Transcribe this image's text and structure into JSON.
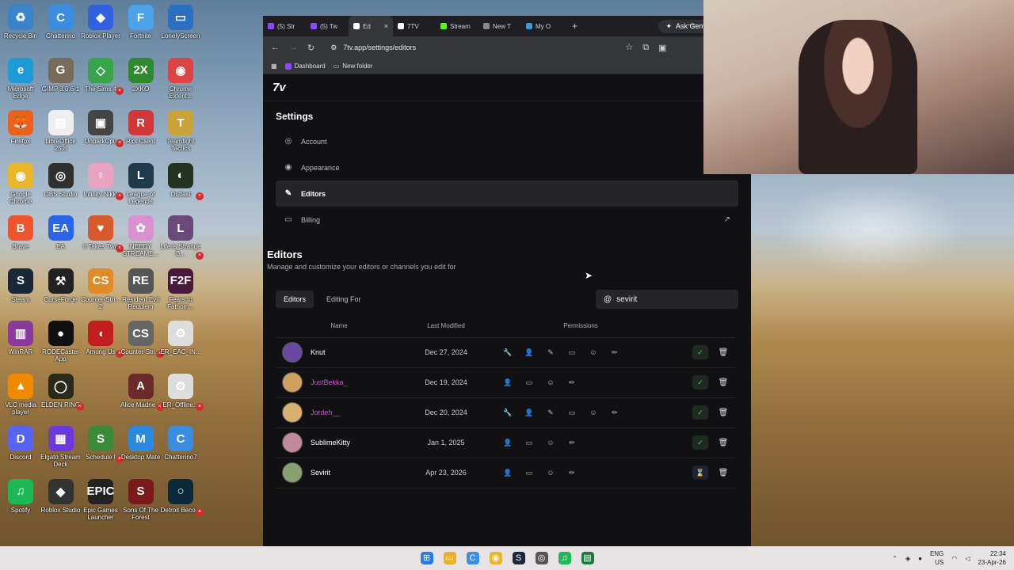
{
  "desktop": {
    "icons": [
      {
        "label": "Recycle Bin",
        "color": "#3a83c9",
        "glyph": "♻",
        "col": 0,
        "row": 0,
        "x": false
      },
      {
        "label": "Chatterino",
        "color": "#3b8de0",
        "glyph": "C",
        "col": 1,
        "row": 0,
        "x": false
      },
      {
        "label": "Roblox Player",
        "color": "#3160e0",
        "glyph": "◆",
        "col": 2,
        "row": 0,
        "x": false
      },
      {
        "label": "Fortnite",
        "color": "#4aa3e8",
        "glyph": "F",
        "col": 3,
        "row": 0,
        "x": false
      },
      {
        "label": "LonelyScreen",
        "color": "#2a6fc0",
        "glyph": "▭",
        "col": 4,
        "row": 0,
        "x": false
      },
      {
        "label": "Microsoft Edge",
        "color": "#1e9ad6",
        "glyph": "e",
        "col": 0,
        "row": 1,
        "x": false
      },
      {
        "label": "GIMP 3.0.6-1",
        "color": "#7a6a5a",
        "glyph": "G",
        "col": 1,
        "row": 1,
        "x": false
      },
      {
        "label": "The Sims 4",
        "color": "#39a54b",
        "glyph": "◇",
        "col": 2,
        "row": 1,
        "x": true
      },
      {
        "label": "2XKO",
        "color": "#2f8a2f",
        "glyph": "2X",
        "col": 3,
        "row": 1,
        "x": false
      },
      {
        "label": "Chrome Extent...",
        "color": "#d44",
        "glyph": "◉",
        "col": 4,
        "row": 1,
        "x": false
      },
      {
        "label": "Firefox",
        "color": "#e8621b",
        "glyph": "🦊",
        "col": 0,
        "row": 2,
        "x": false
      },
      {
        "label": "LibreOffice 25.8",
        "color": "#eee",
        "glyph": "▤",
        "col": 1,
        "row": 2,
        "x": false
      },
      {
        "label": "UnparkCpu",
        "color": "#444",
        "glyph": "▣",
        "col": 2,
        "row": 2,
        "x": true
      },
      {
        "label": "Riot Client",
        "color": "#d13639",
        "glyph": "R",
        "col": 3,
        "row": 2,
        "x": false
      },
      {
        "label": "Teamfight Tactics",
        "color": "#c9a23a",
        "glyph": "T",
        "col": 4,
        "row": 2,
        "x": false
      },
      {
        "label": "Google Chrome",
        "color": "#e9b62c",
        "glyph": "◉",
        "col": 0,
        "row": 3,
        "x": false
      },
      {
        "label": "OBS Studio",
        "color": "#303030",
        "glyph": "◎",
        "col": 1,
        "row": 3,
        "x": false
      },
      {
        "label": "Infinity Nikki",
        "color": "#e7a3c0",
        "glyph": "♀",
        "col": 2,
        "row": 3,
        "x": true
      },
      {
        "label": "League of Legends",
        "color": "#1f3a4a",
        "glyph": "L",
        "col": 3,
        "row": 3,
        "x": false
      },
      {
        "label": "Outlast",
        "color": "#223322",
        "glyph": "◐",
        "col": 4,
        "row": 3,
        "x": true
      },
      {
        "label": "Brave",
        "color": "#f0542d",
        "glyph": "B",
        "col": 0,
        "row": 4,
        "x": false
      },
      {
        "label": "EA",
        "color": "#2a64e8",
        "glyph": "EA",
        "col": 1,
        "row": 4,
        "x": false
      },
      {
        "label": "It Takes Two",
        "color": "#d85a2a",
        "glyph": "♥",
        "col": 2,
        "row": 4,
        "x": true
      },
      {
        "label": "NEEDY STREAME...",
        "color": "#d98fd0",
        "glyph": "✿",
        "col": 3,
        "row": 4,
        "x": false
      },
      {
        "label": "Life is Strange B...",
        "color": "#6a4a7a",
        "glyph": "L",
        "col": 4,
        "row": 4,
        "x": true
      },
      {
        "label": "Steam",
        "color": "#1b2838",
        "glyph": "S",
        "col": 0,
        "row": 5,
        "x": false
      },
      {
        "label": "CurseForge",
        "color": "#222",
        "glyph": "⚒",
        "col": 1,
        "row": 5,
        "x": false
      },
      {
        "label": "Counter-Stri... 2",
        "color": "#e08a2a",
        "glyph": "CS",
        "col": 2,
        "row": 5,
        "x": false
      },
      {
        "label": "Resident Evil Requiem",
        "color": "#555",
        "glyph": "RE",
        "col": 3,
        "row": 5,
        "x": false
      },
      {
        "label": "Fears to Fathom...",
        "color": "#4a1a3a",
        "glyph": "F2F",
        "col": 4,
        "row": 5,
        "x": false
      },
      {
        "label": "WinRAR",
        "color": "#8a3a9a",
        "glyph": "▥",
        "col": 0,
        "row": 6,
        "x": false
      },
      {
        "label": "RODECaster App",
        "color": "#111",
        "glyph": "●",
        "col": 1,
        "row": 6,
        "x": false
      },
      {
        "label": "Among Us",
        "color": "#c31d1d",
        "glyph": "◖",
        "col": 2,
        "row": 6,
        "x": true
      },
      {
        "label": "Counter-Stri...",
        "color": "#666",
        "glyph": "CS",
        "col": 3,
        "row": 6,
        "x": true
      },
      {
        "label": "ER_EAC_IN...",
        "color": "#ddd",
        "glyph": "⚙",
        "col": 4,
        "row": 6,
        "x": false
      },
      {
        "label": "VLC media player",
        "color": "#f08a00",
        "glyph": "▲",
        "col": 0,
        "row": 7,
        "x": false
      },
      {
        "label": "ELDEN RING",
        "color": "#2a2a1a",
        "glyph": "◯",
        "col": 1,
        "row": 7,
        "x": true
      },
      {
        "label": "Alice Madne...",
        "color": "#6a2a2a",
        "glyph": "A",
        "col": 3,
        "row": 7,
        "x": true
      },
      {
        "label": "ER_Offline...",
        "color": "#ddd",
        "glyph": "⚙",
        "col": 4,
        "row": 7,
        "x": true
      },
      {
        "label": "Discord",
        "color": "#5865f2",
        "glyph": "D",
        "col": 0,
        "row": 8,
        "x": false
      },
      {
        "label": "Elgato Stream Deck",
        "color": "#6a3ae0",
        "glyph": "▦",
        "col": 1,
        "row": 8,
        "x": false
      },
      {
        "label": "Schedule I",
        "color": "#3a8a3a",
        "glyph": "S",
        "col": 2,
        "row": 8,
        "x": true
      },
      {
        "label": "Desktop Mate",
        "color": "#2a8ae0",
        "glyph": "M",
        "col": 3,
        "row": 8,
        "x": false
      },
      {
        "label": "Chatterino7",
        "color": "#3b8de0",
        "glyph": "C",
        "col": 4,
        "row": 8,
        "x": false
      },
      {
        "label": "Spotify",
        "color": "#1db954",
        "glyph": "♫",
        "col": 0,
        "row": 9,
        "x": false
      },
      {
        "label": "Roblox Studio",
        "color": "#333",
        "glyph": "◆",
        "col": 1,
        "row": 9,
        "x": false
      },
      {
        "label": "Epic Games Launcher",
        "color": "#222",
        "glyph": "EPIC",
        "col": 2,
        "row": 9,
        "x": false
      },
      {
        "label": "Sons Of The Forest",
        "color": "#7a1a1a",
        "glyph": "S",
        "col": 3,
        "row": 9,
        "x": false
      },
      {
        "label": "Detroit Beco...",
        "color": "#0a2a3a",
        "glyph": "○",
        "col": 4,
        "row": 9,
        "x": true
      }
    ]
  },
  "browser": {
    "tabs": [
      {
        "label": "(5) Str",
        "color": "#9146ff",
        "active": false
      },
      {
        "label": "(5) Tw",
        "color": "#9146ff",
        "active": false
      },
      {
        "label": "Ed",
        "color": "#ffffff",
        "active": true
      },
      {
        "label": "7TV",
        "color": "#ffffff",
        "active": false
      },
      {
        "label": "Stream",
        "color": "#53fc18",
        "active": false
      },
      {
        "label": "New T",
        "color": "#888888",
        "active": false
      },
      {
        "label": "My O",
        "color": "#3a9ad9",
        "active": false
      }
    ],
    "new_tab_label": "+",
    "gemini_label": "Ask Gemini",
    "url": "7tv.app/settings/editors",
    "bookmarks": [
      {
        "label": "Dashboard"
      },
      {
        "label": "New folder"
      }
    ]
  },
  "site": {
    "logo": "7v",
    "settings_title": "Settings",
    "menu": [
      {
        "label": "Account",
        "icon": "◎",
        "active": false
      },
      {
        "label": "Appearance",
        "icon": "◉",
        "active": false
      },
      {
        "label": "Editors",
        "icon": "✎",
        "active": true
      },
      {
        "label": "Billing",
        "icon": "▭",
        "active": false
      }
    ],
    "editors_title": "Editors",
    "editors_subtitle": "Manage and customize your editors or channels you edit for",
    "tab_editors": "Editors",
    "tab_editing_for": "Editing For",
    "search_value": "sevirit",
    "columns": {
      "name": "Name",
      "modified": "Last Modified",
      "permissions": "Permissions"
    },
    "rows": [
      {
        "name": "Knut",
        "color": "#ffffff",
        "date": "Dec 27, 2024",
        "perms": [
          "🔧",
          "👤",
          "✎",
          "▭",
          "☺",
          "✏"
        ],
        "status": "✓",
        "pending": false,
        "avatar": "#6a4aa0"
      },
      {
        "name": "JustBekka_",
        "color": "#e040e0",
        "date": "Dec 19, 2024",
        "perms": [
          "👤",
          "▭",
          "☺",
          "✏"
        ],
        "status": "✓",
        "pending": false,
        "avatar": "#d0a060"
      },
      {
        "name": "Jordeh__",
        "color": "#e040e0",
        "date": "Dec 20, 2024",
        "perms": [
          "🔧",
          "👤",
          "✎",
          "▭",
          "☺",
          "✏"
        ],
        "status": "✓",
        "pending": false,
        "avatar": "#d8b070"
      },
      {
        "name": "SublimeKitty",
        "color": "#ffffff",
        "date": "Jan 1, 2025",
        "perms": [
          "👤",
          "▭",
          "☺",
          "✏"
        ],
        "status": "✓",
        "pending": false,
        "avatar": "#c08a9a"
      },
      {
        "name": "Sevirit",
        "color": "#ffffff",
        "date": "Apr 23, 2026",
        "perms": [
          "👤",
          "▭",
          "☺",
          "✏"
        ],
        "status": "⌛",
        "pending": true,
        "avatar": "#8aa070"
      }
    ]
  },
  "taskbar": {
    "lang": "ENG",
    "region": "US",
    "time": "22:34",
    "date": "23-Apr-26"
  }
}
